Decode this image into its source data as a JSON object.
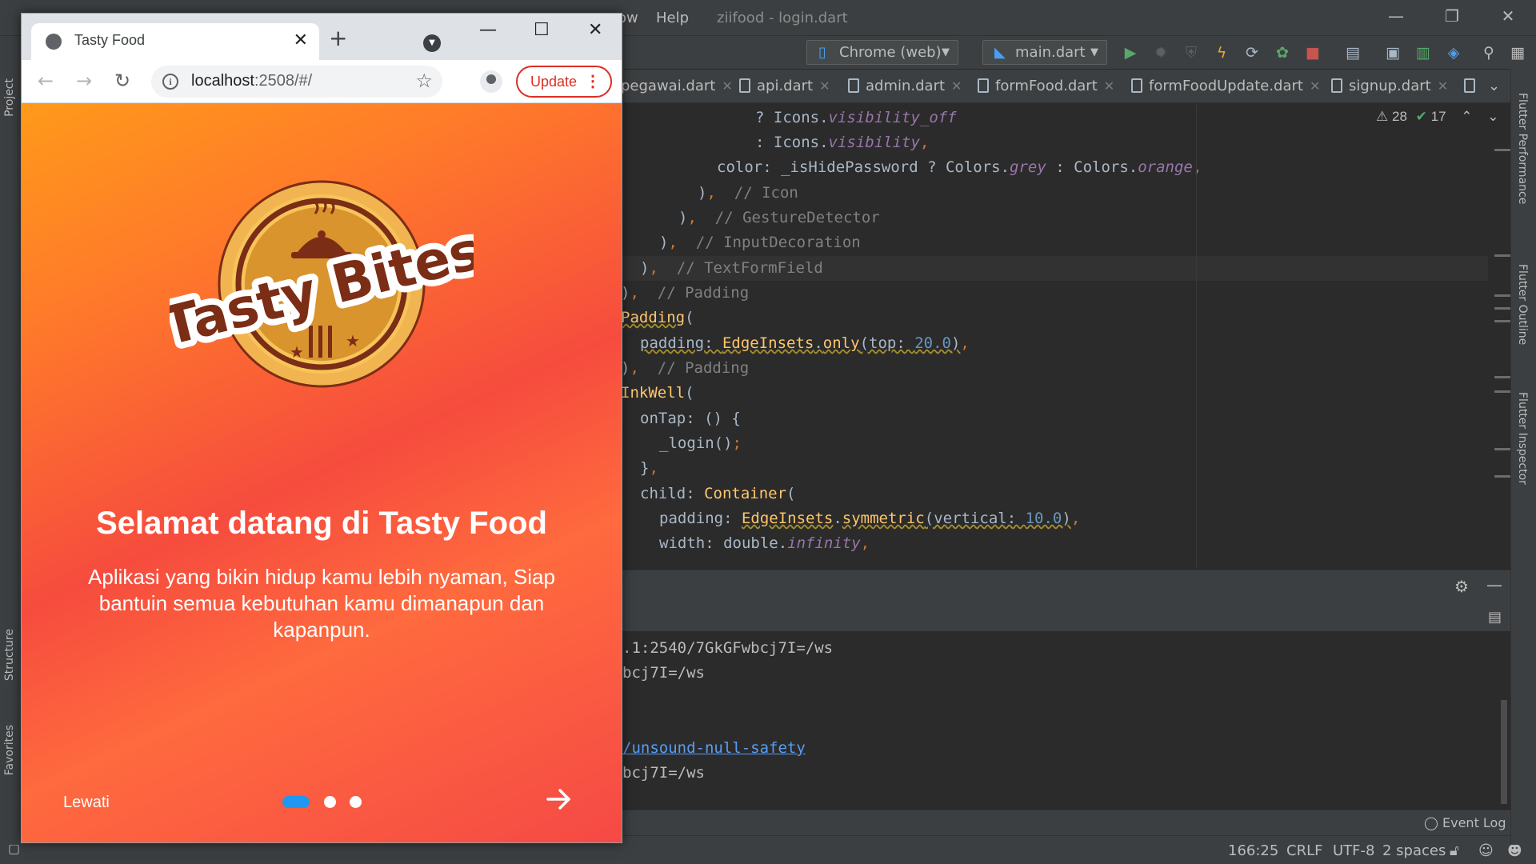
{
  "ide": {
    "menu": {
      "help": "Help",
      "project_file": "ziifood - login.dart",
      "partial_menu": "ow"
    },
    "toolbar": {
      "device": "Chrome (web)",
      "run_config": "main.dart"
    },
    "tabs": [
      "pegawai.dart",
      "api.dart",
      "admin.dart",
      "formFood.dart",
      "formFoodUpdate.dart",
      "signup.dart"
    ],
    "inspection": {
      "warnings": "28",
      "checks": "17"
    },
    "side_left": [
      "Project",
      "Structure",
      "Favorites"
    ],
    "side_right": [
      "Flutter Performance",
      "Flutter Outline",
      "Flutter Inspector"
    ],
    "code": [
      "? Icons.visibility_off",
      ": Icons.visibility,",
      "color: _isHidePassword ? Colors.grey : Colors.orange,",
      "),  // Icon",
      "),  // GestureDetector",
      "),  // InputDecoration",
      "),  // TextFormField",
      "),  // Padding",
      "Padding(",
      "padding: EdgeInsets.only(top: 20.0),",
      "),  // Padding",
      "InkWell(",
      "onTap: () {",
      "_login();",
      "},",
      "child: Container(",
      "padding: EdgeInsets.symmetric(vertical: 10.0),",
      "width: double.infinity,"
    ],
    "output": [
      ".1:2540/7GkGFwbcj7I=/ws",
      "bcj7I=/ws",
      "/unsound-null-safety",
      "bcj7I=/ws"
    ],
    "event_log": "Event Log",
    "status": {
      "position": "166:25",
      "line_sep": "CRLF",
      "encoding": "UTF-8",
      "indent": "2 spaces"
    }
  },
  "browser": {
    "tab_title": "Tasty Food",
    "url_host": "localhost",
    "url_rest": ":2508/#/",
    "update_label": "Update"
  },
  "app": {
    "logo_text": "Tasty Bites",
    "welcome": "Selamat datang di Tasty Food",
    "description": "Aplikasi yang bikin hidup kamu lebih nyaman, Siap bantuin semua kebutuhan kamu dimanapun dan kapanpun.",
    "skip": "Lewati",
    "page_index": 1,
    "page_count": 3,
    "colors": {
      "gradient_top": "#ff9a1a",
      "gradient_bottom": "#f54945",
      "dot_active": "#2196f3"
    }
  }
}
